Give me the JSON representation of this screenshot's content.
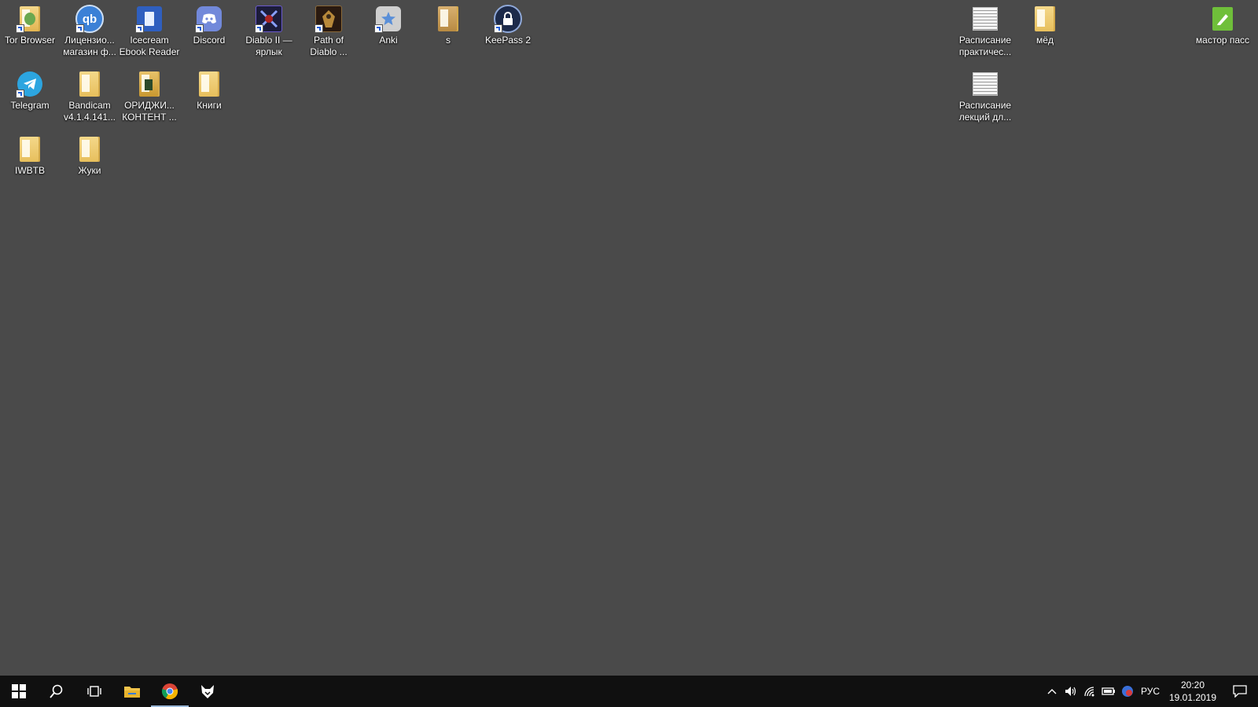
{
  "desktop": {
    "background": "#4a4a4a",
    "icons": [
      {
        "name": "tor-browser",
        "label": "Tor Browser"
      },
      {
        "name": "licensed-store",
        "label": "Лицензио...\nмагазин ф..."
      },
      {
        "name": "icecream-ebook-reader",
        "label": "Icecream\nEbook Reader"
      },
      {
        "name": "discord",
        "label": "Discord"
      },
      {
        "name": "diablo-ii",
        "label": "Diablo II —\nярлык"
      },
      {
        "name": "path-of-diablo",
        "label": "Path of\nDiablo ..."
      },
      {
        "name": "anki",
        "label": "Anki"
      },
      {
        "name": "s-folder",
        "label": "s"
      },
      {
        "name": "keepass-2",
        "label": "KeePass 2"
      },
      {
        "name": "schedule-practice",
        "label": "Расписание\nпрактичес..."
      },
      {
        "name": "med-folder",
        "label": "мёд"
      },
      {
        "name": "master-pass",
        "label": "мастор пасс"
      },
      {
        "name": "telegram",
        "label": "Telegram"
      },
      {
        "name": "bandicam",
        "label": "Bandicam\nv4.1.4.141..."
      },
      {
        "name": "original-content",
        "label": "ОРИДЖИ...\nКОНТЕНТ ..."
      },
      {
        "name": "books-folder",
        "label": "Книги"
      },
      {
        "name": "schedule-lectures",
        "label": "Расписание\nлекций дл..."
      },
      {
        "name": "iwbtb-folder",
        "label": "IWBTB"
      },
      {
        "name": "bugs-folder",
        "label": "Жуки"
      }
    ]
  },
  "taskbar": {
    "background": "#101010",
    "pinned": [
      {
        "name": "start-button",
        "icon": "windows-logo"
      },
      {
        "name": "search-button",
        "icon": "search-icon"
      },
      {
        "name": "task-view-button",
        "icon": "task-view-icon"
      },
      {
        "name": "file-explorer-button",
        "icon": "folder-icon"
      },
      {
        "name": "chrome-button",
        "icon": "chrome-icon",
        "active": true
      },
      {
        "name": "app-button",
        "icon": "fox-icon"
      }
    ],
    "tray": {
      "language": "РУС",
      "time": "20:20",
      "date": "19.01.2019"
    }
  }
}
